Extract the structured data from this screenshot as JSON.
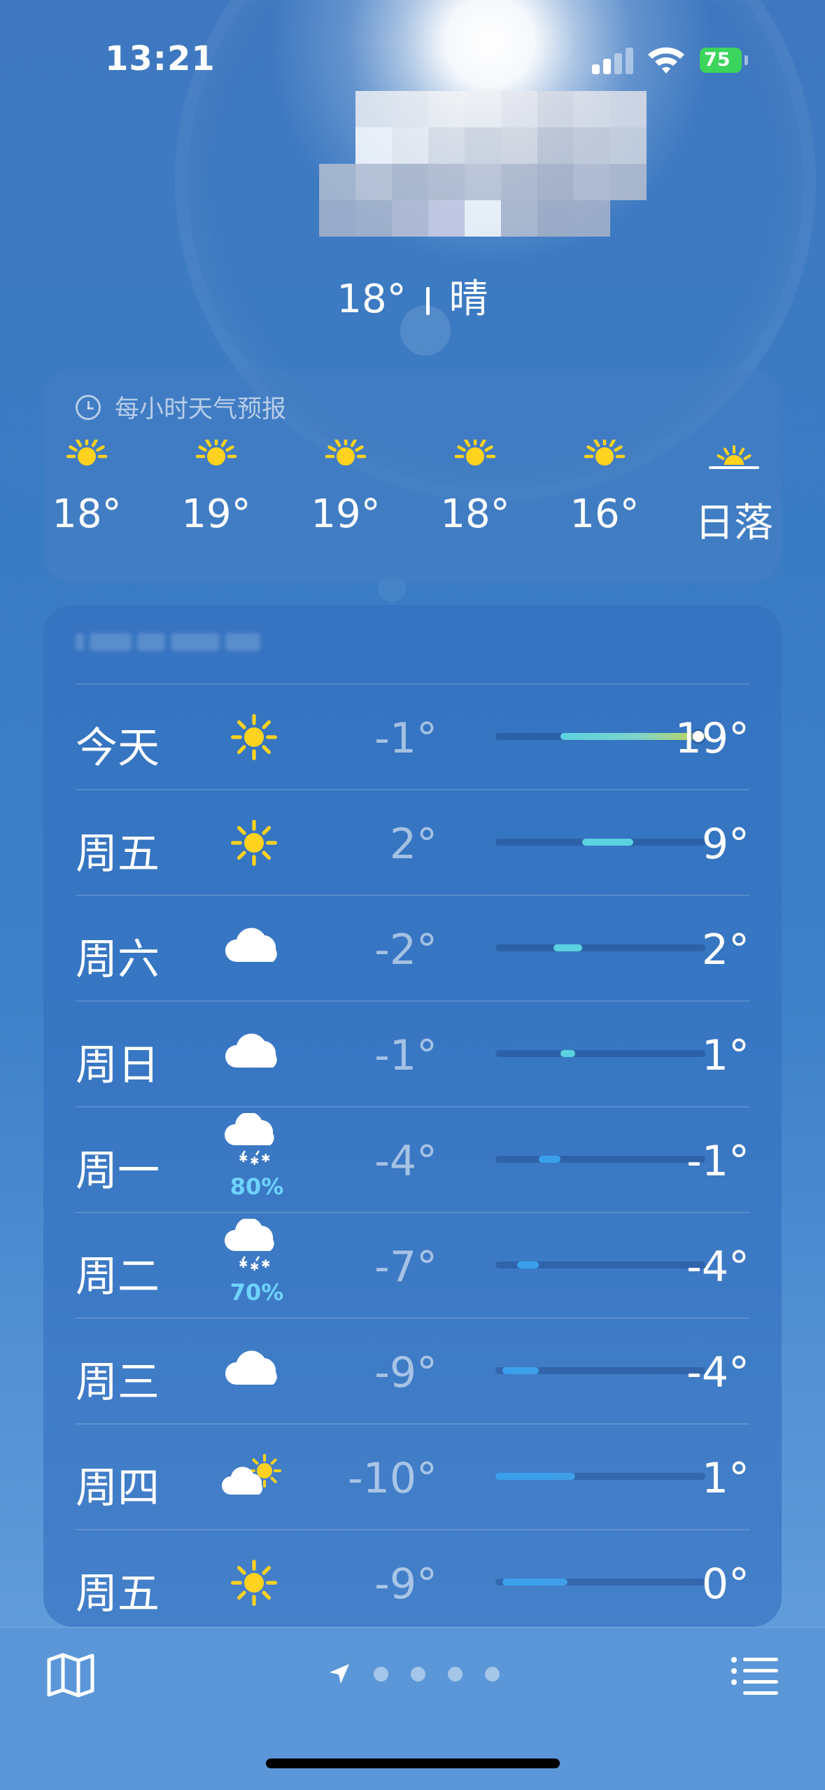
{
  "status_bar": {
    "time": "13:21",
    "battery": "75",
    "battery_color": "#3bd45c"
  },
  "current": {
    "temperature": "18°",
    "condition": "晴"
  },
  "hourly": {
    "title": "每小时天气预报",
    "items": [
      {
        "icon": "sun-icon",
        "temp": "18°"
      },
      {
        "icon": "sun-icon",
        "temp": "19°"
      },
      {
        "icon": "sun-icon",
        "temp": "19°"
      },
      {
        "icon": "sun-icon",
        "temp": "18°"
      },
      {
        "icon": "sun-icon",
        "temp": "16°"
      },
      {
        "icon": "sunset-icon",
        "temp": "日落"
      }
    ]
  },
  "daily": {
    "days": [
      {
        "day": "今天",
        "icon": "sun-icon",
        "precip": "",
        "low": "-1°",
        "high": "19°",
        "low_value": -1,
        "high_value": 19,
        "current_value": 18
      },
      {
        "day": "周五",
        "icon": "sun-icon",
        "precip": "",
        "low": "2°",
        "high": "9°",
        "low_value": 2,
        "high_value": 9
      },
      {
        "day": "周六",
        "icon": "cloud-icon",
        "precip": "",
        "low": "-2°",
        "high": "2°",
        "low_value": -2,
        "high_value": 2
      },
      {
        "day": "周日",
        "icon": "cloud-icon",
        "precip": "",
        "low": "-1°",
        "high": "1°",
        "low_value": -1,
        "high_value": 1
      },
      {
        "day": "周一",
        "icon": "snow-cloud-icon",
        "precip": "80%",
        "low": "-4°",
        "high": "-1°",
        "low_value": -4,
        "high_value": -1
      },
      {
        "day": "周二",
        "icon": "snow-cloud-icon",
        "precip": "70%",
        "low": "-7°",
        "high": "-4°",
        "low_value": -7,
        "high_value": -4
      },
      {
        "day": "周三",
        "icon": "cloud-icon",
        "precip": "",
        "low": "-9°",
        "high": "-4°",
        "low_value": -9,
        "high_value": -4
      },
      {
        "day": "周四",
        "icon": "partly-cloudy-icon",
        "precip": "",
        "low": "-10°",
        "high": "1°",
        "low_value": -10,
        "high_value": 1
      },
      {
        "day": "周五",
        "icon": "sun-icon",
        "precip": "",
        "low": "-9°",
        "high": "0°",
        "low_value": -9,
        "high_value": 0
      }
    ],
    "range_min": -10,
    "range_max": 19
  },
  "toolbar": {
    "map_icon": "map-icon",
    "location_icon": "location-arrow-icon",
    "page_count": 5,
    "list_icon": "list-icon"
  },
  "colors": {
    "sun": "#ffd21f",
    "precip_text": "#6fd3ff",
    "cold_bar": "#3aa0ec",
    "mild_bar": "#5bd2e0"
  }
}
